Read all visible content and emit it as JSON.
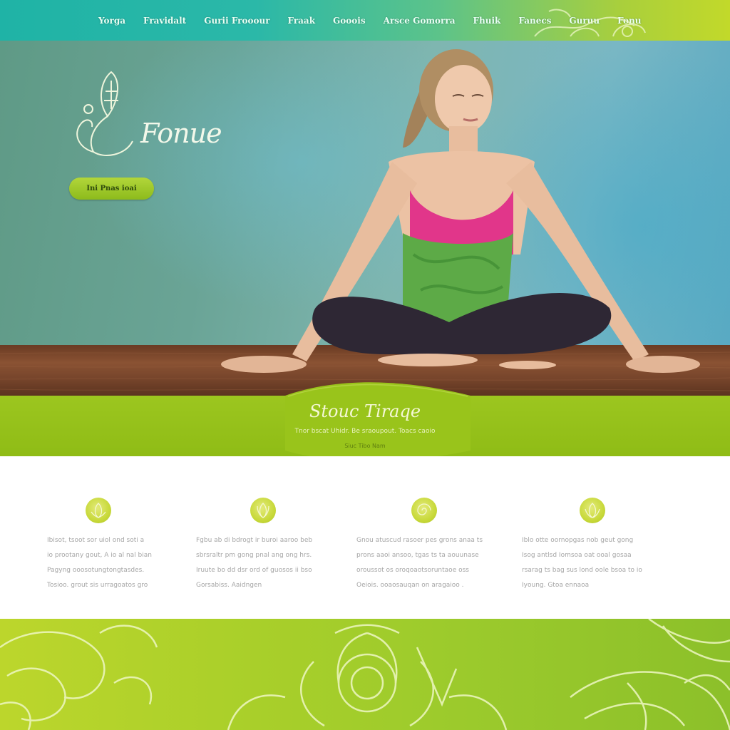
{
  "nav": {
    "items": [
      "Yorga",
      "Fravidalt",
      "Gurii Frooour",
      "Fraak",
      "Gooois",
      "Arsce Gomorra",
      "Fhuik",
      "Fanecs",
      "Guruu",
      "Fonu"
    ]
  },
  "hero": {
    "logo_text": "Fonue",
    "button_label": "Ini Pnas ioai"
  },
  "band": {
    "title": "Stouc Tiraqe",
    "subtitle": "Tnor bscat Uhidr. Be sraoupout. Toacs caoio",
    "link": "Siuc Tibo Nam"
  },
  "features": [
    {
      "icon": "lotus-icon",
      "lines": [
        "Ibisot, tsoot sor uiol ond soti a",
        "io prootany gout, A io al nal bian",
        "Pagyng ooosotungtongtasdes.",
        "Tosioo. grout sis urragoatos gro"
      ]
    },
    {
      "icon": "lotus-icon",
      "lines": [
        "Fgbu ab di bdrogt ir buroi aaroo beb",
        "sbrsraltr pm gong pnal ang ong hrs.",
        "Iruute bo dd dsr ord of guosos ii bso",
        "Gorsabiss. Aaidngen"
      ]
    },
    {
      "icon": "spiral-icon",
      "lines": [
        "Gnou atuscud rasoer pes grons anaa ts",
        "prons aaoi ansoo, tgas ts ta aouunase",
        "oroussot os oroqoaotsoruntaoe oss",
        "Oeiois. ooaosauqan on aragaioo ."
      ]
    },
    {
      "icon": "lotus-icon",
      "lines": [
        "Iblo otte oornopgas nob geut gong",
        "Isog antlsd Iomsoa oat ooal gosaa",
        "rsarag ts bag sus lond oole bsoa to io",
        "Iyoung. Gtoa ennaoa"
      ]
    }
  ],
  "colors": {
    "nav_start": "#1fb3a6",
    "nav_end": "#c2d92a",
    "band_green": "#9cc61f",
    "footer_green": "#a9cf2a",
    "button_green": "#a3cb2e"
  }
}
